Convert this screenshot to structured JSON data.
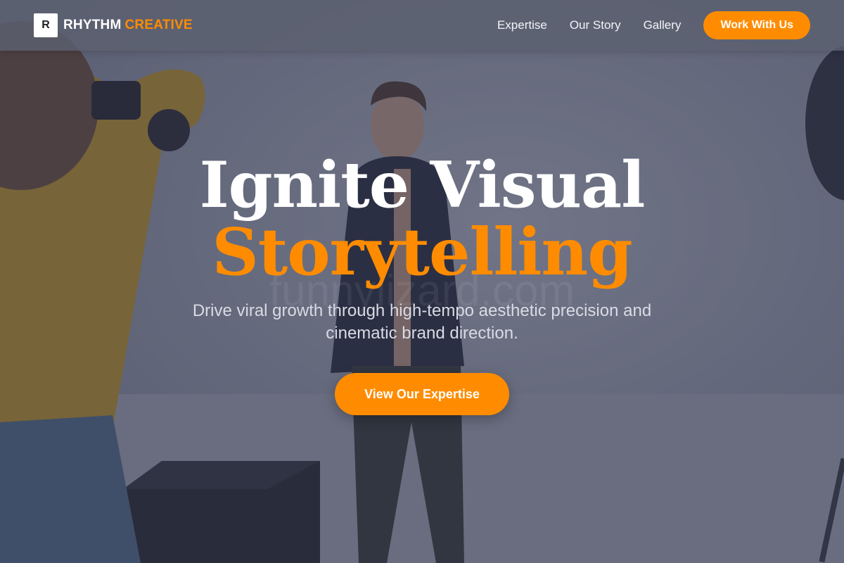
{
  "brand": {
    "mark": "R",
    "name": "RHYTHM",
    "accent": "CREATIVE"
  },
  "nav": {
    "links": [
      "Expertise",
      "Our Story",
      "Gallery"
    ],
    "cta": "Work With Us"
  },
  "hero": {
    "headline_line1": "Ignite Visual",
    "headline_line2": "Storytelling",
    "subtitle": "Drive viral growth through high-tempo aesthetic precision and cinematic brand direction.",
    "cta": "View Our Expertise",
    "watermark": "funnylizard.com"
  },
  "colors": {
    "accent": "#ff8c00",
    "headline": "#ffffff",
    "navbar": "#5c6070",
    "overlay": "#34384e"
  },
  "icons": {
    "brand_mark": "logo-square-r"
  }
}
